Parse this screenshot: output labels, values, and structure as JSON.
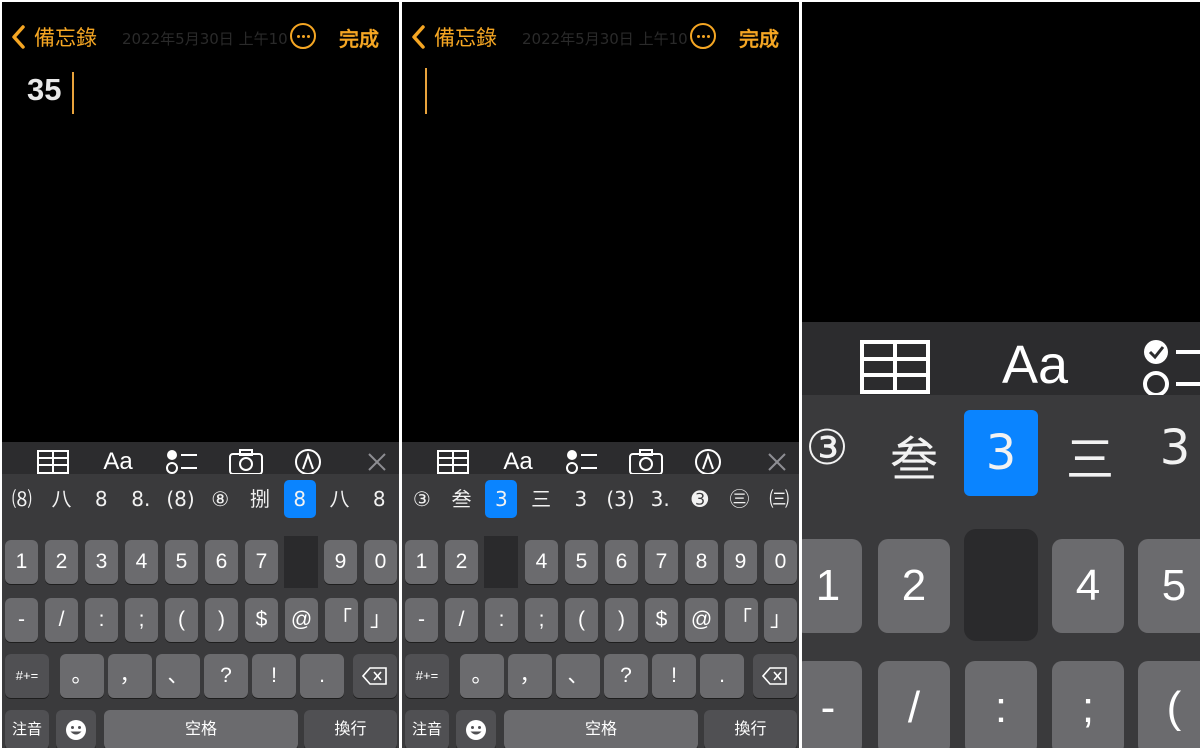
{
  "header": {
    "back_label": "備忘錄",
    "done_label": "完成",
    "ghost_date": "2022年5月30日 上午10"
  },
  "panel1": {
    "note_text": "35",
    "candidates": [
      "⑻八",
      "八",
      "8",
      "8.",
      "(8)",
      "⑧",
      "捌",
      "8",
      "八",
      "8"
    ],
    "selected_index": 7,
    "number_row": [
      "1",
      "2",
      "3",
      "4",
      "5",
      "6",
      "7",
      "",
      "9",
      "0"
    ]
  },
  "panel2": {
    "note_text": "",
    "candidates": [
      "③",
      "叁",
      "3",
      "三",
      "3",
      "(3)",
      "3.",
      "➌",
      "㊂",
      "㈢"
    ],
    "selected_index": 2,
    "number_row": [
      "1",
      "2",
      "",
      "4",
      "5",
      "6",
      "7",
      "8",
      "9",
      "0"
    ]
  },
  "keyboard": {
    "symbol_row": [
      "-",
      "/",
      ":",
      ";",
      "(",
      ")",
      "$",
      "@",
      "「",
      "」"
    ],
    "punct_row": [
      "。",
      "，",
      "、",
      "?",
      "!",
      "."
    ],
    "mode_key": "#+=",
    "lang_key": "注音",
    "space_label": "空格",
    "return_label": "換行"
  },
  "panel3": {
    "toolbar_aa": "Aa",
    "candidates": [
      "③",
      "叁",
      "3",
      "三",
      "3"
    ],
    "selected_index": 2,
    "number_keys": [
      "1",
      "2",
      "",
      "4",
      "5"
    ],
    "symbol_keys": [
      "-",
      "/",
      ":",
      ";",
      "("
    ]
  },
  "colors": {
    "accent": "#f5a623",
    "selection": "#0a84ff",
    "key": "#6b6b6e",
    "keyboard_bg": "#3a3a3c"
  }
}
